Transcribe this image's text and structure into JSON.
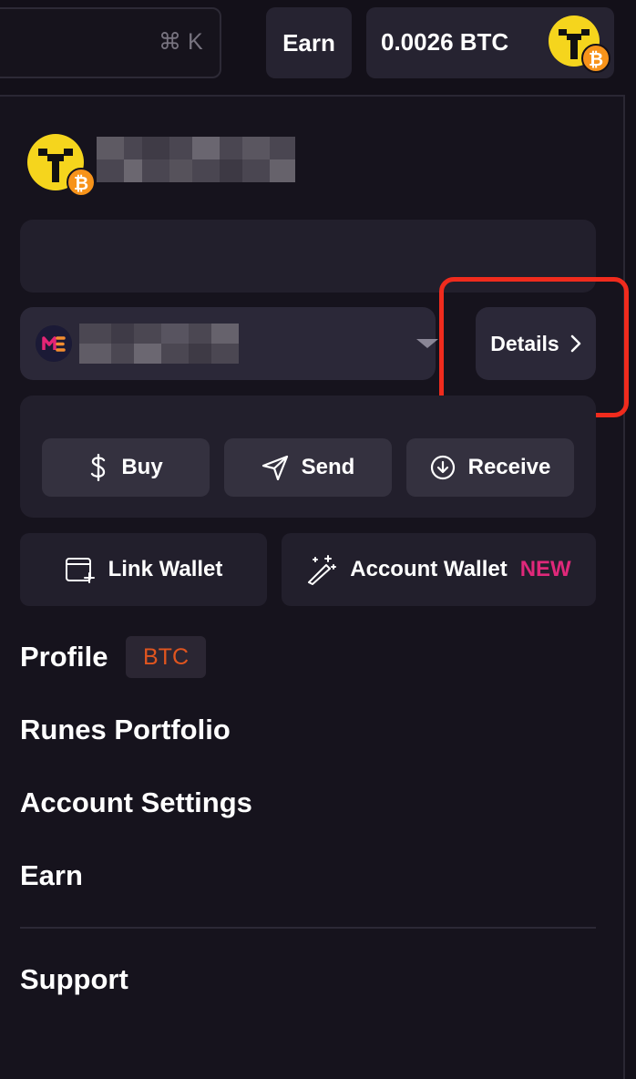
{
  "topbar": {
    "search_hint": "⌘ K",
    "earn_label": "Earn",
    "balance": "0.0026 BTC"
  },
  "wallet": {
    "details_label": "Details"
  },
  "actions": {
    "buy": "Buy",
    "send": "Send",
    "receive": "Receive"
  },
  "wallet_buttons": {
    "link_wallet": "Link Wallet",
    "account_wallet": "Account Wallet",
    "new_badge": "NEW"
  },
  "menu": {
    "profile": "Profile",
    "profile_badge": "BTC",
    "runes_portfolio": "Runes Portfolio",
    "account_settings": "Account Settings",
    "earn": "Earn",
    "support": "Support"
  },
  "colors": {
    "background": "#131019",
    "card": "#221f2c",
    "button": "#34313f",
    "highlight_border": "#f02b1d",
    "new_badge": "#e0287a",
    "btc_badge": "#e0551f",
    "avatar_yellow": "#f5d51d",
    "bitcoin_orange": "#f7931a"
  },
  "icons": [
    "avatar-icon",
    "bitcoin-icon",
    "magic-eden-icon",
    "chevron-right-icon",
    "dollar-icon",
    "send-icon",
    "receive-icon",
    "link-wallet-icon",
    "magic-wand-icon",
    "caret-down-icon"
  ]
}
